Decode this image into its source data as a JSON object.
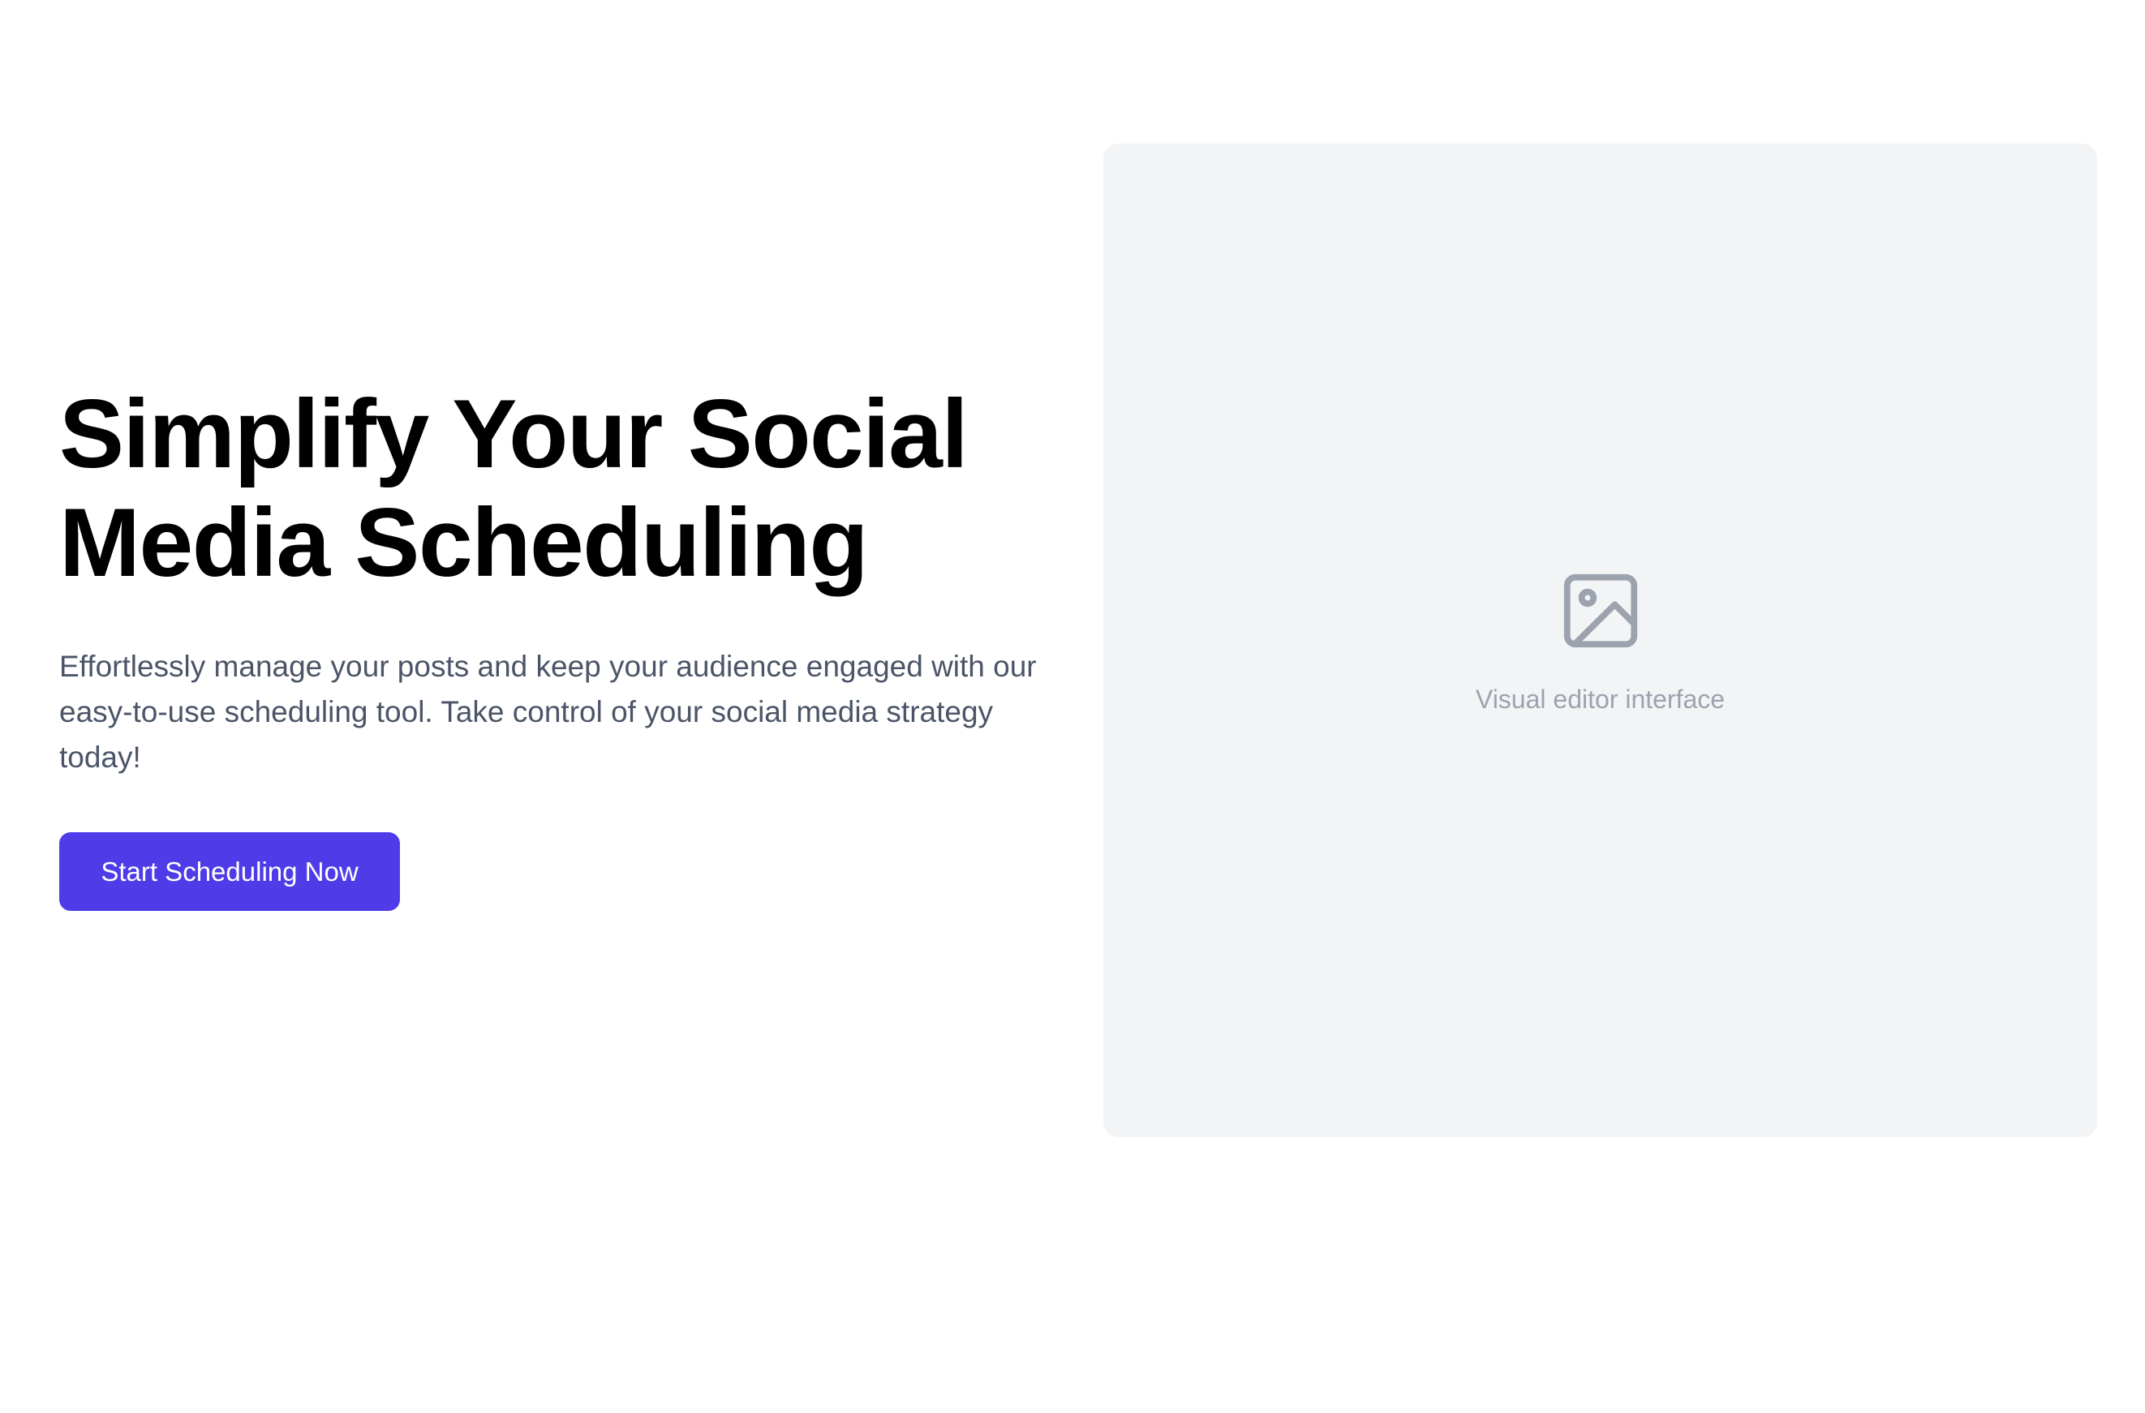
{
  "hero": {
    "headline_line1": "Simplify Your Social",
    "headline_line2": "Media Scheduling",
    "subtext": "Effortlessly manage your posts and keep your audience engaged with our easy-to-use scheduling tool. Take control of your social media strategy today!",
    "cta_label": "Start Scheduling Now"
  },
  "preview": {
    "icon": "image-icon",
    "caption": "Visual editor interface"
  },
  "colors": {
    "accent": "#4f3ce8",
    "heading": "#000000",
    "body_text": "#4b5567",
    "placeholder_bg": "#f3f4f6",
    "placeholder_text": "#9ca3af"
  }
}
